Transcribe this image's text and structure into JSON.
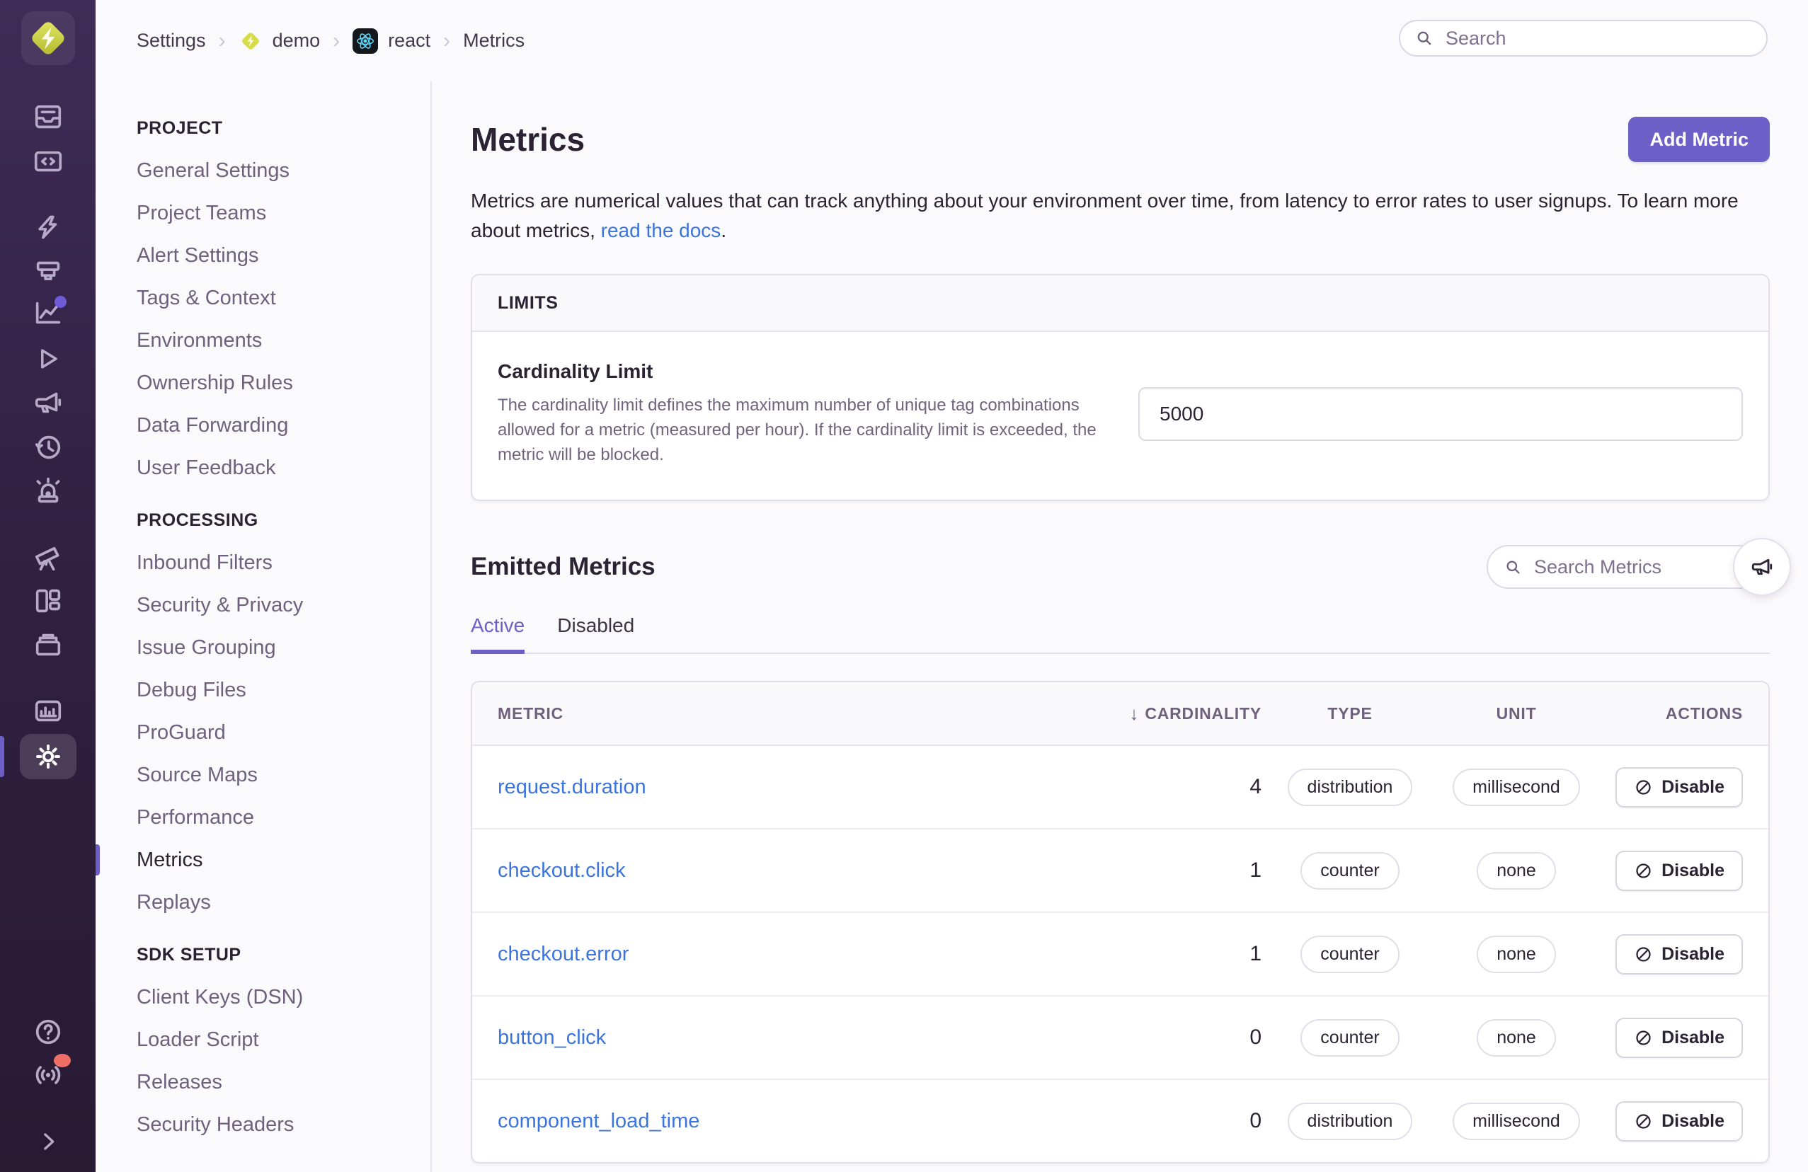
{
  "app": {
    "brand": "Sentry"
  },
  "colors": {
    "accent": "#6C5FC7",
    "link": "#3C74DD",
    "sidebar_top": "#3E2C56",
    "sidebar_bottom": "#281A33",
    "alert_dot": "#EF6F66",
    "notification_dot": "#6F5BD5",
    "project_lime": "#D6DB48",
    "react_blue": "#61DAFB"
  },
  "topbar": {
    "search_placeholder": "Search",
    "breadcrumb": {
      "items": [
        {
          "label": "Settings"
        },
        {
          "label": "demo",
          "icon": "sentry-project-icon"
        },
        {
          "label": "react",
          "icon": "react-icon"
        },
        {
          "label": "Metrics"
        }
      ]
    }
  },
  "primary_sidebar": {
    "icons": [
      "issues-icon",
      "code-folder-icon",
      "lightning-icon",
      "printer-icon",
      "insights-chart-icon",
      "play-icon",
      "megaphone-icon",
      "history-icon",
      "siren-icon",
      "telescope-icon",
      "dashboards-icon",
      "archive-icon",
      "stats-icon",
      "settings-gear-icon",
      "help-icon",
      "broadcast-icon",
      "collapse-chevron-icon"
    ],
    "active_icon": "settings-gear-icon"
  },
  "settings_nav": {
    "sections": [
      {
        "heading": "PROJECT",
        "items": [
          {
            "label": "General Settings"
          },
          {
            "label": "Project Teams"
          },
          {
            "label": "Alert Settings"
          },
          {
            "label": "Tags & Context"
          },
          {
            "label": "Environments"
          },
          {
            "label": "Ownership Rules"
          },
          {
            "label": "Data Forwarding"
          },
          {
            "label": "User Feedback"
          }
        ]
      },
      {
        "heading": "PROCESSING",
        "items": [
          {
            "label": "Inbound Filters"
          },
          {
            "label": "Security & Privacy"
          },
          {
            "label": "Issue Grouping"
          },
          {
            "label": "Debug Files"
          },
          {
            "label": "ProGuard"
          },
          {
            "label": "Source Maps"
          },
          {
            "label": "Performance"
          },
          {
            "label": "Metrics",
            "active": true
          },
          {
            "label": "Replays"
          }
        ]
      },
      {
        "heading": "SDK SETUP",
        "items": [
          {
            "label": "Client Keys (DSN)"
          },
          {
            "label": "Loader Script"
          },
          {
            "label": "Releases"
          },
          {
            "label": "Security Headers"
          }
        ]
      }
    ]
  },
  "page": {
    "title": "Metrics",
    "add_button": "Add Metric",
    "description_lead": "Metrics are numerical values that can track anything about your environment over time, from latency to error rates to user signups. To learn more about metrics, ",
    "doc_link_label": "read the docs",
    "description_tail": "."
  },
  "limits": {
    "header": "LIMITS",
    "label": "Cardinality Limit",
    "description": "The cardinality limit defines the maximum number of unique tag combinations allowed for a metric (measured per hour). If the cardinality limit is exceeded, the metric will be blocked.",
    "value": "5000"
  },
  "emitted": {
    "title": "Emitted Metrics",
    "search_placeholder": "Search Metrics",
    "tabs": [
      {
        "label": "Active",
        "active": true
      },
      {
        "label": "Disabled",
        "active": false
      }
    ]
  },
  "table": {
    "sort_arrow": "↓",
    "columns": [
      {
        "label": "METRIC",
        "align": "left"
      },
      {
        "label": "CARDINALITY",
        "align": "right",
        "sorted": true
      },
      {
        "label": "TYPE",
        "align": "center"
      },
      {
        "label": "UNIT",
        "align": "center"
      },
      {
        "label": "ACTIONS",
        "align": "right"
      }
    ],
    "rows": [
      {
        "metric": "request.duration",
        "cardinality": "4",
        "type": "distribution",
        "unit": "millisecond",
        "action": "Disable"
      },
      {
        "metric": "checkout.click",
        "cardinality": "1",
        "type": "counter",
        "unit": "none",
        "action": "Disable"
      },
      {
        "metric": "checkout.error",
        "cardinality": "1",
        "type": "counter",
        "unit": "none",
        "action": "Disable"
      },
      {
        "metric": "button_click",
        "cardinality": "0",
        "type": "counter",
        "unit": "none",
        "action": "Disable"
      },
      {
        "metric": "component_load_time",
        "cardinality": "0",
        "type": "distribution",
        "unit": "millisecond",
        "action": "Disable"
      }
    ]
  }
}
